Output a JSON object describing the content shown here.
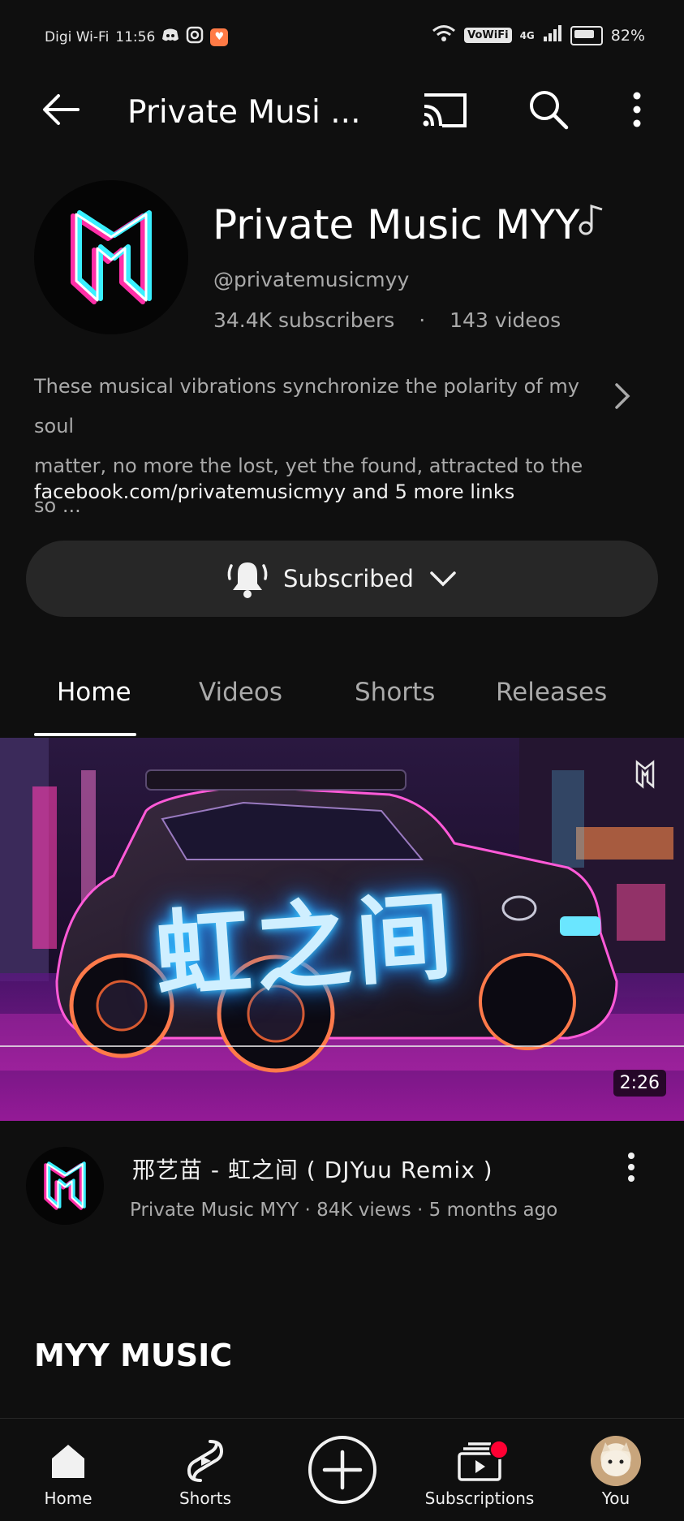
{
  "status_bar": {
    "carrier": "Digi Wi-Fi",
    "time": "11:56",
    "vowifi": "VoWiFi",
    "network": "4G",
    "battery": "82%"
  },
  "top_bar": {
    "title": "Private Musi ..."
  },
  "channel": {
    "name": "Private Music MYY",
    "handle": "@privatemusicmyy",
    "subscribers": "34.4K subscribers",
    "separator": "·",
    "videos": "143 videos",
    "description_line1": "These musical vibrations synchronize the polarity of my soul",
    "description_line2": "matter, no more the lost, yet the found, attracted to the so ...",
    "links": "facebook.com/privatemusicmyy and 5 more links",
    "subscribe_label": "Subscribed"
  },
  "tabs": [
    {
      "label": "Home",
      "active": true
    },
    {
      "label": "Videos",
      "active": false
    },
    {
      "label": "Shorts",
      "active": false
    },
    {
      "label": "Releases",
      "active": false
    }
  ],
  "featured_video": {
    "thumbnail_text": "虹之间",
    "duration": "2:26",
    "title": "邢艺苗 - 虹之间 ( DJYuu Remix )",
    "meta": "Private Music MYY · 84K views · 5 months ago"
  },
  "section": {
    "title": "MYY MUSIC"
  },
  "bottom_nav": [
    {
      "label": "Home",
      "icon": "home-icon"
    },
    {
      "label": "Shorts",
      "icon": "shorts-icon"
    },
    {
      "label": "",
      "icon": "create-icon"
    },
    {
      "label": "Subscriptions",
      "icon": "subscriptions-icon"
    },
    {
      "label": "You",
      "icon": "you-avatar"
    }
  ],
  "colors": {
    "background": "#0f0f0f",
    "button": "#272727",
    "secondary_text": "#aaaaaa",
    "notification": "#ff0033",
    "logo_cyan": "#39f0ff",
    "logo_pink": "#ff2fa8"
  }
}
